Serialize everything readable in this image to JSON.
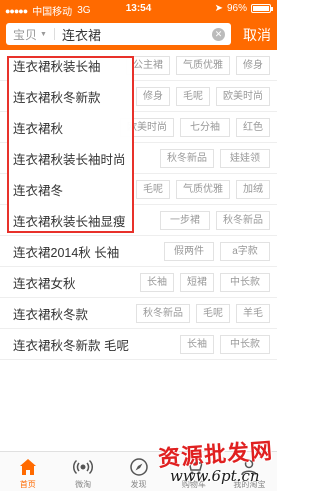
{
  "status_bar": {
    "carrier": "中国移动",
    "network": "3G",
    "time": "13:54",
    "battery": "96%",
    "battery_level": 0.96
  },
  "search": {
    "scope": "宝贝",
    "query": "连衣裙",
    "cancel": "取消"
  },
  "suggestions": [
    {
      "keyword": "连衣裙秋装长袖",
      "tags": [
        "公主裙",
        "气质优雅",
        "修身"
      ]
    },
    {
      "keyword": "连衣裙秋冬新款",
      "tags": [
        "修身",
        "毛呢",
        "欧美时尚"
      ]
    },
    {
      "keyword": "连衣裙秋",
      "tags": [
        "欧美时尚",
        "七分袖",
        "红色"
      ]
    },
    {
      "keyword": "连衣裙秋装长袖时尚",
      "tags": [
        "秋冬新品",
        "娃娃领"
      ]
    },
    {
      "keyword": "连衣裙冬",
      "tags": [
        "毛呢",
        "气质优雅",
        "加绒"
      ]
    },
    {
      "keyword": "连衣裙秋装长袖显瘦",
      "tags": [
        "一步裙",
        "秋冬新品"
      ]
    },
    {
      "keyword": "连衣裙2014秋 长袖",
      "tags": [
        "假两件",
        "a字款"
      ]
    },
    {
      "keyword": "连衣裙女秋",
      "tags": [
        "长袖",
        "短裙",
        "中长款"
      ]
    },
    {
      "keyword": "连衣裙秋冬款",
      "tags": [
        "秋冬新品",
        "毛呢",
        "羊毛"
      ]
    },
    {
      "keyword": "连衣裙秋冬新款 毛呢",
      "tags": [
        "长袖",
        "中长款"
      ]
    }
  ],
  "tab_bar": {
    "tabs": [
      {
        "label": "首页",
        "icon": "home-icon"
      },
      {
        "label": "微淘",
        "icon": "broadcast-icon"
      },
      {
        "label": "发现",
        "icon": "compass-icon"
      },
      {
        "label": "购物车",
        "icon": "cart-icon"
      },
      {
        "label": "我的淘宝",
        "icon": "person-icon"
      }
    ]
  },
  "watermark": {
    "text": "资源批发网",
    "url": "www.6pt.cn"
  },
  "colors": {
    "brand": "#ff6a00",
    "highlight": "#e8312a",
    "watermark": "#e02020"
  }
}
